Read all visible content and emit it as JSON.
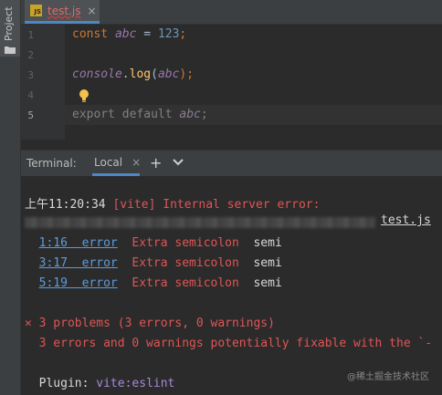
{
  "sidebar": {
    "project_label": "Project"
  },
  "editor_tab": {
    "icon_text": "JS",
    "filename": "test.js",
    "close": "×"
  },
  "editor": {
    "line_numbers": [
      "1",
      "2",
      "3",
      "4",
      "5"
    ],
    "line1": {
      "kw": "const",
      "var": "abc",
      "rest": " = ",
      "num": "123",
      "end": ";"
    },
    "line3": {
      "obj": "console",
      "dot": ".",
      "fn": "log",
      "open": "(",
      "arg": "abc",
      "close": ");"
    },
    "line5": {
      "text": "export default ",
      "var": "abc",
      "end": ";"
    }
  },
  "terminal_header": {
    "title": "Terminal:",
    "tab_local": "Local",
    "tab_close": "×",
    "new_tab": "+"
  },
  "terminal": {
    "timestamp": "上午11:20:34",
    "vite_error": "[vite] Internal server error:",
    "file": "test.js",
    "problems": [
      {
        "loc": "1:16",
        "level": "error",
        "msg": "Extra semicolon",
        "rule": "semi"
      },
      {
        "loc": "3:17",
        "level": "error",
        "msg": "Extra semicolon",
        "rule": "semi"
      },
      {
        "loc": "5:19",
        "level": "error",
        "msg": "Extra semicolon",
        "rule": "semi"
      }
    ],
    "summary_mark": "✕",
    "summary": "3 problems (3 errors, 0 warnings)",
    "fixable": "3 errors and 0 warnings potentially fixable with the `-",
    "plugin_label": "Plugin:",
    "plugin_name": "vite:eslint"
  },
  "watermark": "@稀土掘金技术社区",
  "colors": {
    "accent": "#4a88c7",
    "error": "#e05555",
    "link": "#5c9dde"
  }
}
